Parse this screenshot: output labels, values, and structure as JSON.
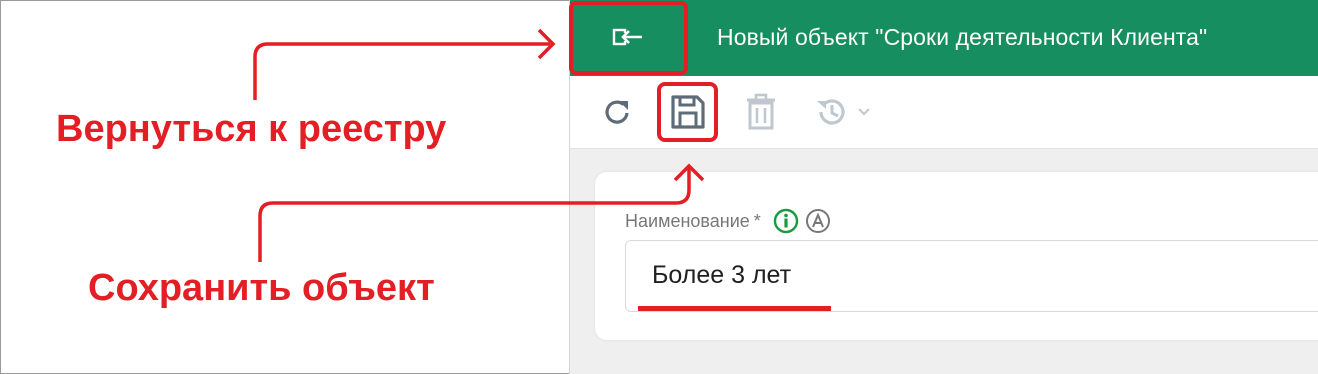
{
  "header": {
    "title": "Новый объект \"Сроки деятельности Клиента\"",
    "background": "#178e5f",
    "back_icon": "exit-arrow-icon"
  },
  "toolbar": {
    "buttons": [
      {
        "name": "refresh",
        "icon": "refresh-icon"
      },
      {
        "name": "save",
        "icon": "save-icon"
      },
      {
        "name": "delete",
        "icon": "trash-icon"
      },
      {
        "name": "history",
        "icon": "history-icon"
      }
    ]
  },
  "form": {
    "name_field": {
      "label": "Наименование",
      "required_mark": "*",
      "value": "Более 3 лет"
    }
  },
  "annotations": {
    "back": "Вернуться к реестру",
    "save": "Сохранить объект",
    "color": "#e31e24"
  }
}
